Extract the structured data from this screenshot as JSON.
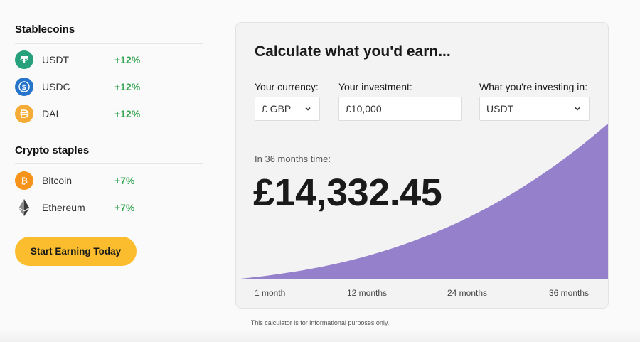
{
  "sidebar": {
    "stablecoins_title": "Stablecoins",
    "stablecoins": [
      {
        "name": "USDT",
        "rate": "+12%",
        "icon": "tether-icon",
        "color": "#26a17b"
      },
      {
        "name": "USDC",
        "rate": "+12%",
        "icon": "usdc-icon",
        "color": "#2775ca"
      },
      {
        "name": "DAI",
        "rate": "+12%",
        "icon": "dai-icon",
        "color": "#f5ac37"
      }
    ],
    "staples_title": "Crypto staples",
    "staples": [
      {
        "name": "Bitcoin",
        "rate": "+7%",
        "icon": "bitcoin-icon",
        "color": "#f7931a"
      },
      {
        "name": "Ethereum",
        "rate": "+7%",
        "icon": "ethereum-icon",
        "color": "#343434"
      }
    ],
    "cta_label": "Start Earning Today"
  },
  "calculator": {
    "title": "Calculate what you'd earn...",
    "currency_label": "Your currency:",
    "currency_value": "£ GBP",
    "investment_label": "Your investment:",
    "investment_value": "£10,000",
    "asset_label": "What you're investing in:",
    "asset_value": "USDT",
    "time_label": "In 36 months time:",
    "result_value": "£14,332.45",
    "timeline": [
      "1 month",
      "12 months",
      "24 months",
      "36 months"
    ],
    "curve_color": "#9580cc"
  },
  "disclaimer": "This calculator is for informational purposes only."
}
